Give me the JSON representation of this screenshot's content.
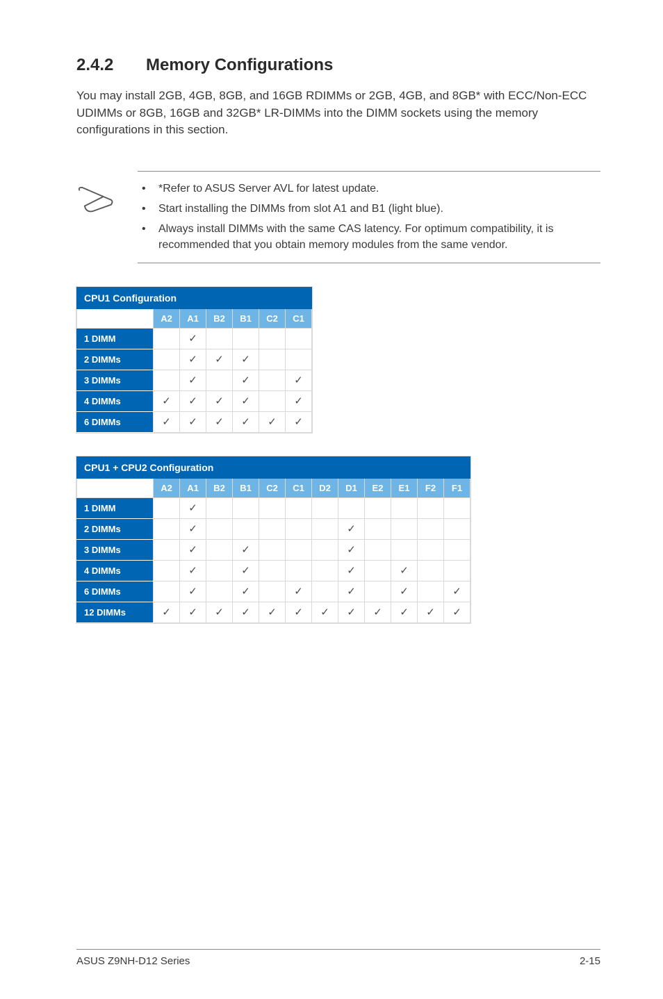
{
  "section": {
    "number": "2.4.2",
    "title": "Memory Configurations"
  },
  "intro": "You may install 2GB, 4GB, 8GB, and 16GB RDIMMs or 2GB, 4GB, and 8GB* with ECC/Non-ECC UDIMMs or 8GB, 16GB and 32GB* LR-DIMMs into the DIMM sockets using the memory configurations in this section.",
  "notes": [
    "*Refer to ASUS Server AVL for latest update.",
    "Start installing the DIMMs from slot A1 and B1 (light blue).",
    "Always install DIMMs with the same CAS latency. For optimum compatibility, it is recommended that you obtain memory modules from the same vendor."
  ],
  "check": "✓",
  "table1": {
    "title": "CPU1 Configuration",
    "cols": [
      "A2",
      "A1",
      "B2",
      "B1",
      "C2",
      "C1"
    ],
    "rows": [
      {
        "label": "1 DIMM",
        "c": [
          "",
          "1",
          "",
          "",
          "",
          ""
        ]
      },
      {
        "label": "2 DIMMs",
        "c": [
          "",
          "1",
          "1",
          "1",
          "",
          ""
        ]
      },
      {
        "label": "3 DIMMs",
        "c": [
          "",
          "1",
          "",
          "1",
          "",
          "1"
        ]
      },
      {
        "label": "4 DIMMs",
        "c": [
          "1",
          "1",
          "1",
          "1",
          "",
          "1"
        ]
      },
      {
        "label": "6 DIMMs",
        "c": [
          "1",
          "1",
          "1",
          "1",
          "1",
          "1"
        ]
      }
    ]
  },
  "table2": {
    "title": "CPU1 + CPU2 Configuration",
    "cols": [
      "A2",
      "A1",
      "B2",
      "B1",
      "C2",
      "C1",
      "D2",
      "D1",
      "E2",
      "E1",
      "F2",
      "F1"
    ],
    "rows": [
      {
        "label": "1 DIMM",
        "c": [
          "",
          "1",
          "",
          "",
          "",
          "",
          "",
          "",
          "",
          "",
          "",
          ""
        ]
      },
      {
        "label": "2 DIMMs",
        "c": [
          "",
          "1",
          "",
          "",
          "",
          "",
          "",
          "1",
          "",
          "",
          "",
          ""
        ]
      },
      {
        "label": "3 DIMMs",
        "c": [
          "",
          "1",
          "",
          "1",
          "",
          "",
          "",
          "1",
          "",
          "",
          "",
          ""
        ]
      },
      {
        "label": "4 DIMMs",
        "c": [
          "",
          "1",
          "",
          "1",
          "",
          "",
          "",
          "1",
          "",
          "1",
          "",
          ""
        ]
      },
      {
        "label": "6 DIMMs",
        "c": [
          "",
          "1",
          "",
          "1",
          "",
          "1",
          "",
          "1",
          "",
          "1",
          "",
          "1"
        ]
      },
      {
        "label": "12 DIMMs",
        "c": [
          "1",
          "1",
          "1",
          "1",
          "1",
          "1",
          "1",
          "1",
          "1",
          "1",
          "1",
          "1"
        ]
      }
    ]
  },
  "footer": {
    "left": "ASUS Z9NH-D12 Series",
    "right": "2-15"
  }
}
